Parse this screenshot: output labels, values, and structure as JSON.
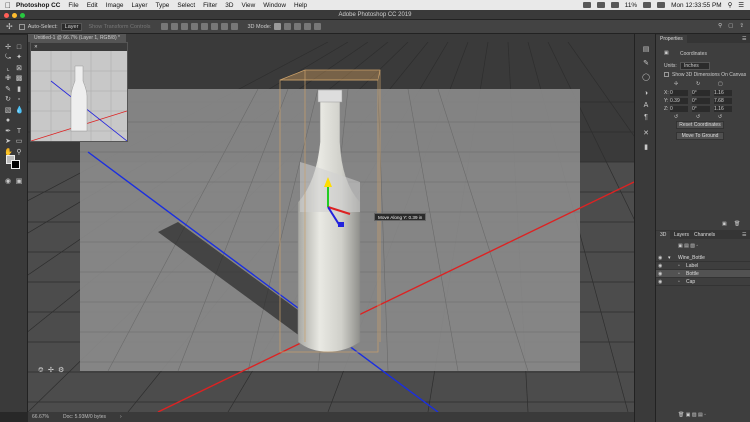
{
  "menubar": {
    "app_name": "Photoshop CC",
    "items": [
      "File",
      "Edit",
      "Image",
      "Layer",
      "Type",
      "Select",
      "Filter",
      "3D",
      "View",
      "Window",
      "Help"
    ],
    "battery": "11%",
    "clock": "Mon 12:33:55 PM"
  },
  "window": {
    "title": "Adobe Photoshop CC 2019"
  },
  "options_bar": {
    "auto_select_label": "Auto-Select:",
    "auto_select_value": "Layer",
    "show_transform": "Show Transform Controls",
    "mode_3d": "3D Mode:"
  },
  "document": {
    "tab_title": "Untitled-1 @ 66.7% (Layer 1, RGB/8) *"
  },
  "canvas": {
    "tooltip": "Move Along Y: 0.39 in"
  },
  "statusbar": {
    "zoom": "66.67%",
    "doc_info": "Doc: 5.93M/0 bytes"
  },
  "properties": {
    "tab": "Properties",
    "section": "Coordinates",
    "units_label": "Units:",
    "units_value": "Inches",
    "show_dims": "Show 3D Dimensions On Canvas",
    "x_label": "X:",
    "y_label": "Y:",
    "z_label": "Z:",
    "x_pos": "0",
    "y_pos": "0.39",
    "z_pos": "0",
    "x_rot": "0°",
    "y_rot": "0°",
    "z_rot": "0°",
    "x_scale": "1.16",
    "y_scale": "7.68",
    "z_scale": "1.16",
    "reset_button": "Reset Coordinates",
    "ground_button": "Move To Ground"
  },
  "layers_panel": {
    "tabs": [
      "3D",
      "Layers",
      "Channels"
    ],
    "items": [
      {
        "name": "Wine_Bottle"
      },
      {
        "name": "Label"
      },
      {
        "name": "Bottle"
      },
      {
        "name": "Cap"
      }
    ]
  }
}
